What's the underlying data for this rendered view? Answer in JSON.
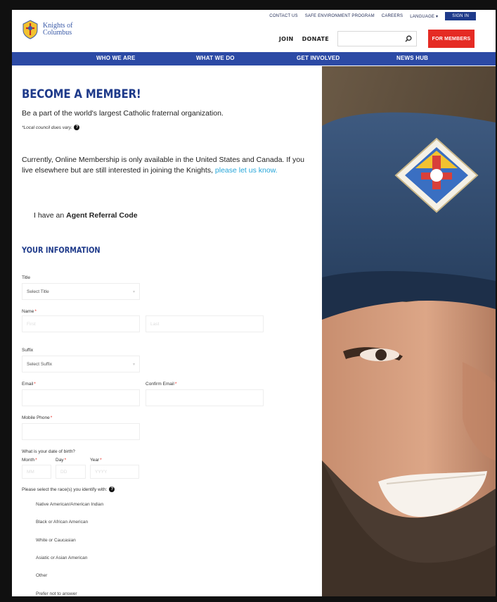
{
  "utility": {
    "contact": "CONTACT US",
    "safe_env": "SAFE ENVIRONMENT PROGRAM",
    "careers": "CAREERS",
    "language": "LANGUAGE",
    "sign_in": "SIGN IN"
  },
  "brand": {
    "line1": "Knights of",
    "line2": "Columbus"
  },
  "actions": {
    "join": "JOIN",
    "donate": "DONATE",
    "search_placeholder": "",
    "for_members": "FOR MEMBERS"
  },
  "nav": [
    "WHO WE ARE",
    "WHAT WE DO",
    "GET INVOLVED",
    "NEWS HUB"
  ],
  "page": {
    "title": "BECOME A MEMBER!",
    "subtitle": "Be a part of the world's largest Catholic fraternal organization.",
    "dues_note": "*Local council dues vary.",
    "notice_text": "Currently, Online Membership is only available in the United States and Canada. If you live elsewhere but are still interested in joining the Knights, ",
    "notice_link": "please let us know.",
    "agent_prefix": "I have an ",
    "agent_bold": "Agent Referral Code",
    "section_title": "YOUR INFORMATION"
  },
  "form": {
    "title_label": "Title",
    "title_value": "Select Title",
    "name_label": "Name",
    "first_placeholder": "First",
    "last_placeholder": "Last",
    "suffix_label": "Suffix",
    "suffix_value": "Select Suffix",
    "email_label": "Email",
    "confirm_email_label": "Confirm Email",
    "mobile_label": "Mobile Phone",
    "dob_question": "What is your date of birth?",
    "month_label": "Month",
    "day_label": "Day",
    "year_label": "Year",
    "month_placeholder": "MM",
    "day_placeholder": "DD",
    "year_placeholder": "YYYY",
    "race_question": "Please select the race(s) you identify with:",
    "races": [
      "Native American/American Indian",
      "Black or African American",
      "White or Caucasian",
      "Asiatic or Asian American",
      "Other",
      "Prefer not to answer"
    ]
  },
  "colors": {
    "brand_blue": "#2c4aa5",
    "title_blue": "#1e3a8a",
    "cta_red": "#e52b24",
    "link_cyan": "#27a6d9"
  }
}
